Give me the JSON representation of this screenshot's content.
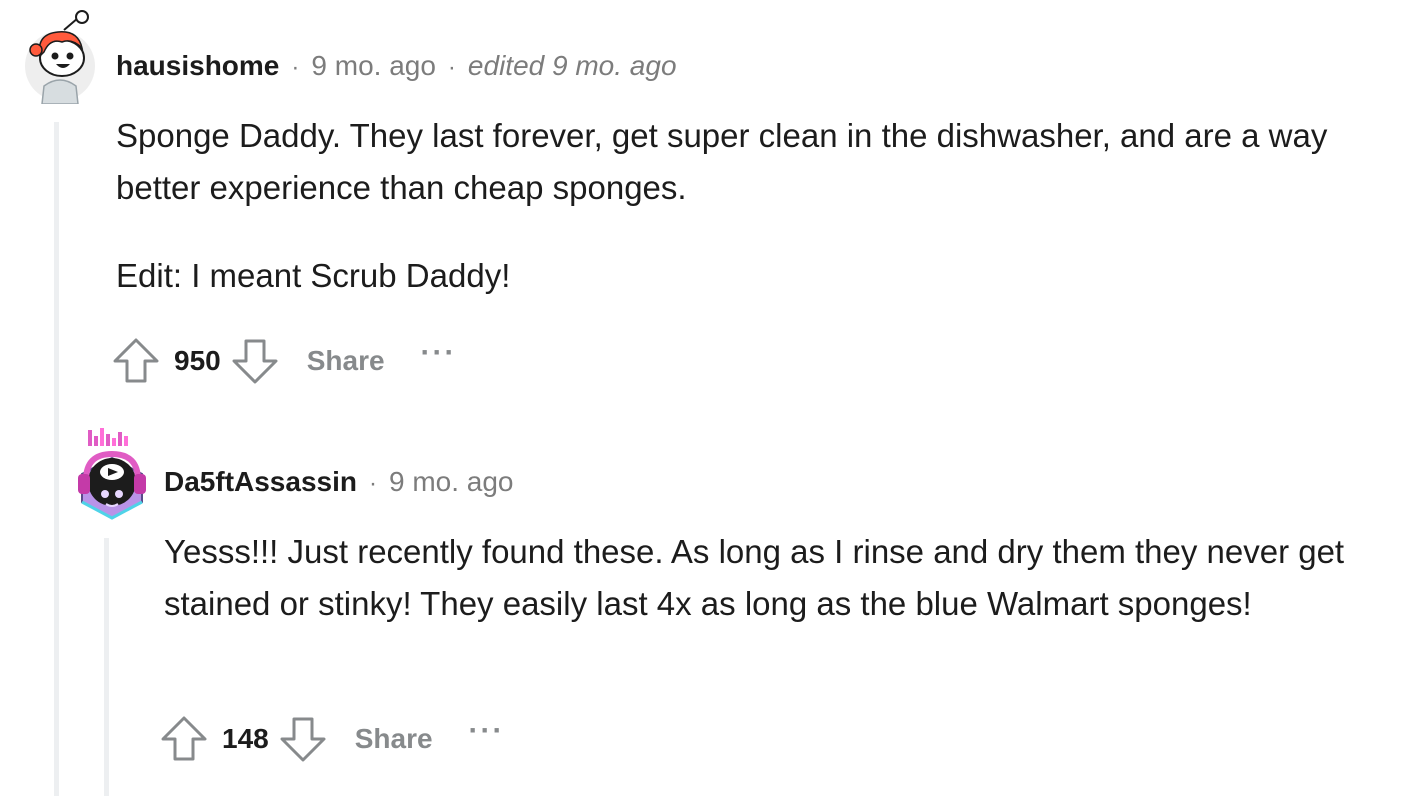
{
  "comments": [
    {
      "author": "hausishome",
      "age": "9 mo. ago",
      "edited": "edited 9 mo. ago",
      "body": [
        "Sponge Daddy. They last forever, get super clean in the dishwasher, and are a way better experience than cheap sponges.",
        "Edit: I meant Scrub Daddy!"
      ],
      "score": "950",
      "share_label": "Share",
      "more_label": "···"
    },
    {
      "author": "Da5ftAssassin",
      "age": "9 mo. ago",
      "body": [
        "Yesss!!! Just recently found these. As long as I rinse and dry them they never get stained or stinky! They easily last 4x as long as the blue Walmart sponges!"
      ],
      "score": "148",
      "share_label": "Share",
      "more_label": "···"
    }
  ],
  "separator": "·",
  "icons": {
    "avatar_1": "snoo-avatar-red-hair-icon",
    "avatar_2": "snoo-avatar-dj-headphones-icon",
    "upvote": "upvote-arrow-icon",
    "downvote": "downvote-arrow-icon"
  },
  "colors": {
    "text": "#1c1c1c",
    "muted": "#7c7c7c",
    "action": "#878a8c",
    "thread_line": "#edeff1"
  }
}
